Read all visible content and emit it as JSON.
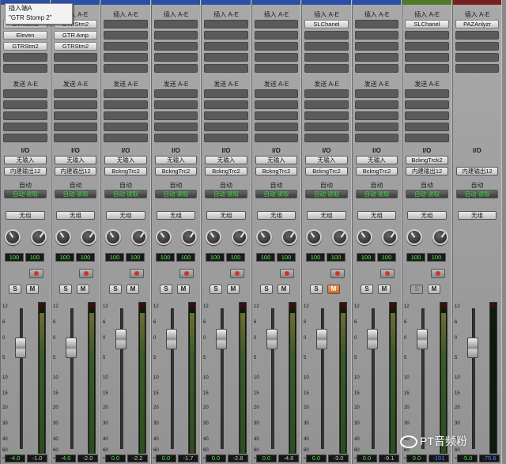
{
  "tooltip": {
    "line1": "插入端A",
    "line2": "\"GTR Stomp 2\""
  },
  "watermark": "PT音频粉",
  "labels": {
    "inserts": "插入 A-E",
    "sends": "发送 A-E",
    "io": "I/O",
    "auto": "自动",
    "group": "无组",
    "rec": "",
    "solo": "S",
    "mute": "M"
  },
  "colors": {
    "accent_green": "#53f053",
    "mute_on": "#d4661e",
    "peak_blue": "#4d86ff"
  },
  "channels": [
    {
      "color": "#2a4fa8",
      "inserts": [
        "GTRStm2",
        "Eleven",
        "GTRStm2",
        "",
        ""
      ],
      "sends_label": "发送 A-E",
      "io_in": "无输入",
      "io_out": "内建输出12",
      "auto": "自动 读取",
      "pan_l": "100",
      "pan_r": "100",
      "mute": false,
      "solo_disabled": false,
      "fader_pos": 0.28,
      "meter_level": 0.93,
      "volume": "-4.0",
      "peak": "-1.0",
      "peak_blue": false
    },
    {
      "color": "#2a4fa8",
      "inserts": [
        "GTRStm2",
        "GTR Amp",
        "GTRStm2",
        "",
        ""
      ],
      "sends_label": "发送 A-E",
      "io_in": "无输入",
      "io_out": "内建输出12",
      "auto": "自动 读取",
      "pan_l": "100",
      "pan_r": "100",
      "mute": false,
      "solo_disabled": false,
      "fader_pos": 0.28,
      "meter_level": 0.93,
      "volume": "-4.0",
      "peak": "-2.0",
      "peak_blue": false
    },
    {
      "color": "#2a4fa8",
      "inserts": [
        "",
        "",
        "",
        "",
        ""
      ],
      "sends_label": "发送 A-E",
      "io_in": "无输入",
      "io_out": "BckngTrc2",
      "auto": "自动 读取",
      "pan_l": "100",
      "pan_r": "100",
      "mute": false,
      "solo_disabled": false,
      "fader_pos": 0.22,
      "meter_level": 0.93,
      "volume": "0.0",
      "peak": "-2.2",
      "peak_blue": false
    },
    {
      "color": "#2a4fa8",
      "inserts": [
        "",
        "",
        "",
        "",
        ""
      ],
      "sends_label": "发送 A-E",
      "io_in": "无输入",
      "io_out": "BckngTrc2",
      "auto": "自动 读取",
      "pan_l": "100",
      "pan_r": "100",
      "mute": false,
      "solo_disabled": false,
      "fader_pos": 0.22,
      "meter_level": 0.93,
      "volume": "0.0",
      "peak": "-1.7",
      "peak_blue": false
    },
    {
      "color": "#2a4fa8",
      "inserts": [
        "",
        "",
        "",
        "",
        ""
      ],
      "sends_label": "发送 A-E",
      "io_in": "无输入",
      "io_out": "BckngTrc2",
      "auto": "自动 读取",
      "pan_l": "100",
      "pan_r": "100",
      "mute": false,
      "solo_disabled": false,
      "fader_pos": 0.22,
      "meter_level": 0.93,
      "volume": "0.0",
      "peak": "-2.8",
      "peak_blue": false
    },
    {
      "color": "#2a4fa8",
      "inserts": [
        "",
        "",
        "",
        "",
        ""
      ],
      "sends_label": "发送 A-E",
      "io_in": "无输入",
      "io_out": "BckngTrc2",
      "auto": "自动 读取",
      "pan_l": "100",
      "pan_r": "100",
      "mute": false,
      "solo_disabled": false,
      "fader_pos": 0.22,
      "meter_level": 0.93,
      "volume": "0.0",
      "peak": "-4.6",
      "peak_blue": false
    },
    {
      "color": "#2a4fa8",
      "inserts": [
        "SLChanel",
        "",
        "",
        "",
        ""
      ],
      "sends_label": "发送 A-E",
      "io_in": "无输入",
      "io_out": "BckngTrc2",
      "auto": "自动 读取",
      "pan_l": "100",
      "pan_r": "100",
      "mute": true,
      "solo_disabled": false,
      "fader_pos": 0.22,
      "meter_level": 0.93,
      "volume": "0.0",
      "peak": "-3.0",
      "peak_blue": false
    },
    {
      "color": "#2a4fa8",
      "inserts": [
        "",
        "",
        "",
        "",
        ""
      ],
      "sends_label": "发送 A-E",
      "io_in": "无输入",
      "io_out": "BckngTrc2",
      "auto": "自动 读取",
      "pan_l": "100",
      "pan_r": "100",
      "mute": false,
      "solo_disabled": false,
      "fader_pos": 0.22,
      "meter_level": 0.93,
      "volume": "0.0",
      "peak": "-9.1",
      "peak_blue": false
    },
    {
      "color": "#4f7a2a",
      "inserts": [
        "SLChanel",
        "",
        "",
        "",
        ""
      ],
      "sends_label": "发送 A-E",
      "io_in": "BckngTrck2",
      "io_out": "内建输出12",
      "auto": "自动 读取",
      "pan_l": "100",
      "pan_r": "100",
      "mute": false,
      "solo_disabled": true,
      "fader_pos": 0.22,
      "meter_level": 0.93,
      "volume": "0.0",
      "peak": "-101",
      "peak_blue": true
    },
    {
      "color": "#7a1f1f",
      "inserts": [
        "PAZAnlyzr",
        "",
        "",
        "",
        ""
      ],
      "sends_label": "",
      "io_in": "",
      "io_out": "内建输出12",
      "auto": "自动 读取",
      "pan_l": "",
      "pan_r": "",
      "mute": false,
      "solo_disabled": false,
      "fader_pos": 0.28,
      "meter_level": 0.0,
      "volume": "-5.0",
      "peak": "-75.6",
      "peak_blue": true,
      "master": true
    }
  ],
  "scale_ticks": [
    "12",
    "6",
    "0",
    "5",
    "10",
    "15",
    "20",
    "30",
    "40",
    "60",
    "∞"
  ]
}
